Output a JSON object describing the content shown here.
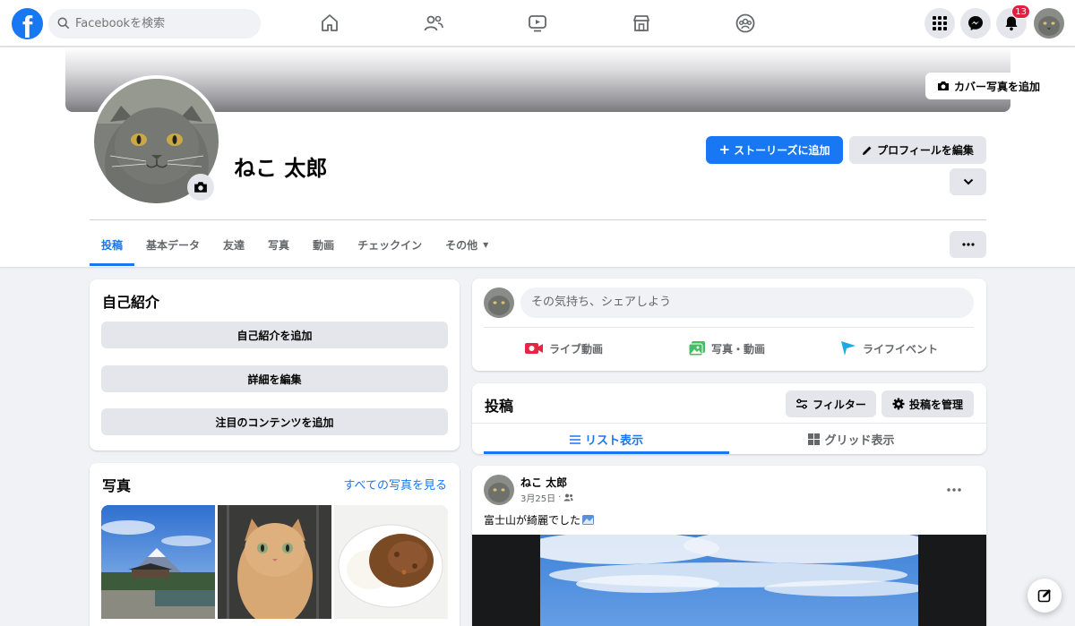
{
  "topbar": {
    "search_placeholder": "Facebookを検索",
    "notification_count": "13"
  },
  "cover": {
    "add_cover_label": "カバー写真を追加"
  },
  "profile": {
    "name": "ねこ 太郎",
    "add_story_label": "ストーリーズに追加",
    "edit_profile_label": "プロフィールを編集"
  },
  "tabs": [
    {
      "label": "投稿"
    },
    {
      "label": "基本データ"
    },
    {
      "label": "友達"
    },
    {
      "label": "写真"
    },
    {
      "label": "動画"
    },
    {
      "label": "チェックイン"
    },
    {
      "label": "その他"
    }
  ],
  "intro": {
    "title": "自己紹介",
    "add_bio": "自己紹介を追加",
    "edit_details": "詳細を編集",
    "add_featured": "注目のコンテンツを追加"
  },
  "photos": {
    "title": "写真",
    "see_all": "すべての写真を見る"
  },
  "composer": {
    "placeholder": "その気持ち、シェアしよう",
    "live_video": "ライブ動画",
    "photo_video": "写真・動画",
    "life_event": "ライフイベント"
  },
  "posts": {
    "title": "投稿",
    "filter": "フィルター",
    "manage": "投稿を管理",
    "list_view": "リスト表示",
    "grid_view": "グリッド表示"
  },
  "post": {
    "author": "ねこ 太郎",
    "date": "3月25日",
    "text": "富士山が綺麗でした"
  },
  "colors": {
    "brand": "#1877f2",
    "badge": "#e41e3f"
  }
}
